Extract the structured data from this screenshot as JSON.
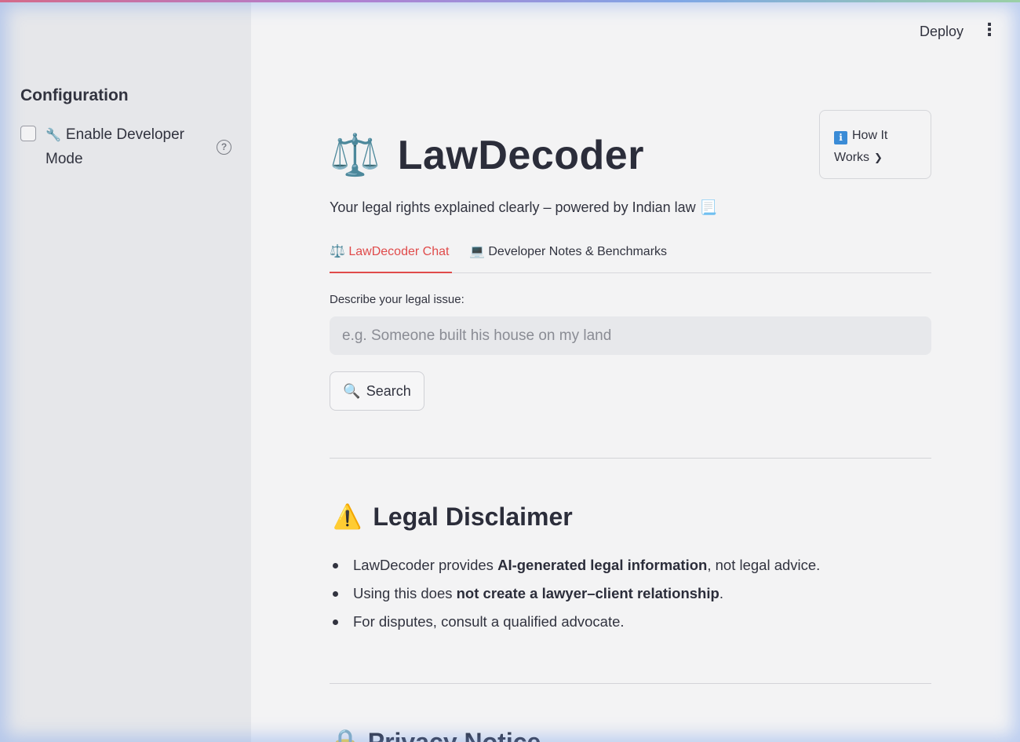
{
  "header": {
    "deploy_label": "Deploy",
    "menu_icon": "kebab-menu-icon"
  },
  "sidebar": {
    "title": "Configuration",
    "developer_mode": {
      "icon": "wrench-icon",
      "label": "Enable Developer Mode",
      "checked": false
    }
  },
  "main": {
    "title_icon": "⚖️",
    "title": "LawDecoder",
    "subtitle": "Your legal rights explained clearly – powered by Indian law",
    "subtitle_icon": "📃",
    "how_it_works": {
      "icon": "ℹ",
      "label": "How It Works"
    },
    "tabs": [
      {
        "icon": "⚖️",
        "label": "LawDecoder Chat",
        "active": true
      },
      {
        "icon": "💻",
        "label": "Developer Notes & Benchmarks",
        "active": false
      }
    ],
    "input": {
      "label": "Describe your legal issue:",
      "placeholder": "e.g. Someone built his house on my land",
      "value": ""
    },
    "search_button": {
      "icon": "🔍",
      "label": "Search"
    },
    "disclaimer": {
      "icon": "⚠️",
      "title": "Legal Disclaimer",
      "items": [
        {
          "pre": "LawDecoder provides ",
          "bold": "AI-generated legal information",
          "post": ", not legal advice."
        },
        {
          "pre": "Using this does ",
          "bold": "not create a lawyer–client relationship",
          "post": "."
        },
        {
          "pre": "For disputes, consult a qualified advocate.",
          "bold": "",
          "post": ""
        }
      ]
    },
    "privacy": {
      "icon": "🔒",
      "title": "Privacy Notice"
    }
  },
  "colors": {
    "accent": "#e04b4b",
    "sidebar_bg": "#e6e7ea",
    "main_bg": "#f3f3f4",
    "input_bg": "#e7e8eb"
  }
}
